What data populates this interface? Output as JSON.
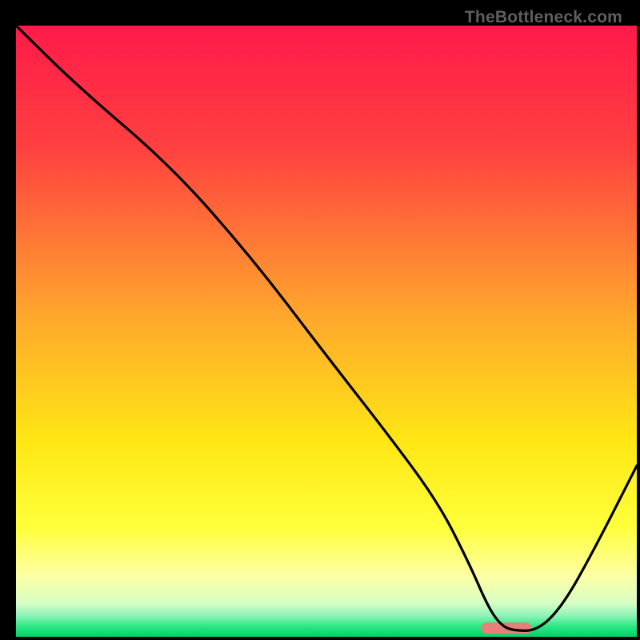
{
  "watermark": "TheBottleneck.com",
  "chart_data": {
    "type": "line",
    "title": "",
    "xlabel": "",
    "ylabel": "",
    "xlim": [
      0,
      100
    ],
    "ylim": [
      0,
      100
    ],
    "gradient_stops": [
      {
        "offset": 0.0,
        "color": "#ff1a4a"
      },
      {
        "offset": 0.2,
        "color": "#ff4040"
      },
      {
        "offset": 0.48,
        "color": "#ffa92c"
      },
      {
        "offset": 0.68,
        "color": "#ffe714"
      },
      {
        "offset": 0.82,
        "color": "#ffff3a"
      },
      {
        "offset": 0.9,
        "color": "#fdffa4"
      },
      {
        "offset": 0.945,
        "color": "#d7ffc5"
      },
      {
        "offset": 0.965,
        "color": "#8ef4b7"
      },
      {
        "offset": 0.985,
        "color": "#23e57e"
      },
      {
        "offset": 1.0,
        "color": "#04d06a"
      }
    ],
    "series": [
      {
        "name": "bottleneck-curve",
        "x": [
          0,
          10,
          25,
          38,
          50,
          60,
          68,
          73,
          76,
          78,
          80,
          84,
          88,
          93,
          100
        ],
        "y": [
          100,
          90,
          77,
          62,
          46,
          33,
          22,
          12,
          5,
          2,
          1,
          1,
          5,
          14,
          28
        ]
      }
    ],
    "marker": {
      "name": "selected-range",
      "x_start": 75,
      "x_end": 83,
      "y": 1.4,
      "color": "#e87f78"
    }
  }
}
